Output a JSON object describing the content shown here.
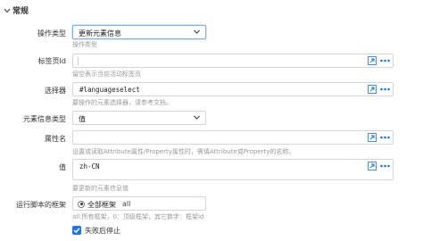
{
  "section": {
    "title": "常规"
  },
  "colors": {
    "accent": "#1a73e8",
    "hint": "#9a9a9a",
    "border": "#d5d5d5"
  },
  "operation_type": {
    "label": "操作类型",
    "value": "更新元素信息",
    "hint": "操作类型"
  },
  "tab_id": {
    "label": "标签页Id",
    "value": "",
    "hint": "留空表示当前活动标签页"
  },
  "selector": {
    "label": "选择器",
    "value": "#languageselect",
    "hint": "要操作的元素选择器，请参考文档。"
  },
  "element_info_type": {
    "label": "元素信息类型",
    "value": "值"
  },
  "property_name": {
    "label": "属性名",
    "value": "",
    "hint": "设置或读取Attribute属性/Property属性时，需填Attribute或Property的名称。"
  },
  "value_field": {
    "label": "值",
    "value": "zh-CN",
    "hint": "要更新的元素信息值"
  },
  "run_frame": {
    "label": "运行脚本的框架",
    "option_label": "全部框架",
    "value": "all",
    "hint": "all:所有框架，0：顶级框架，其它数字：框架id"
  },
  "stop_on_failure": {
    "label": "失败后停止",
    "checked": true
  },
  "icons": {
    "section_toggle": "chevron-down-icon",
    "select_caret": "chevron-down-icon",
    "field_expand": "expand-arrow-icon",
    "field_more": "more-dots-icon",
    "checkbox": "checkmark-icon"
  }
}
